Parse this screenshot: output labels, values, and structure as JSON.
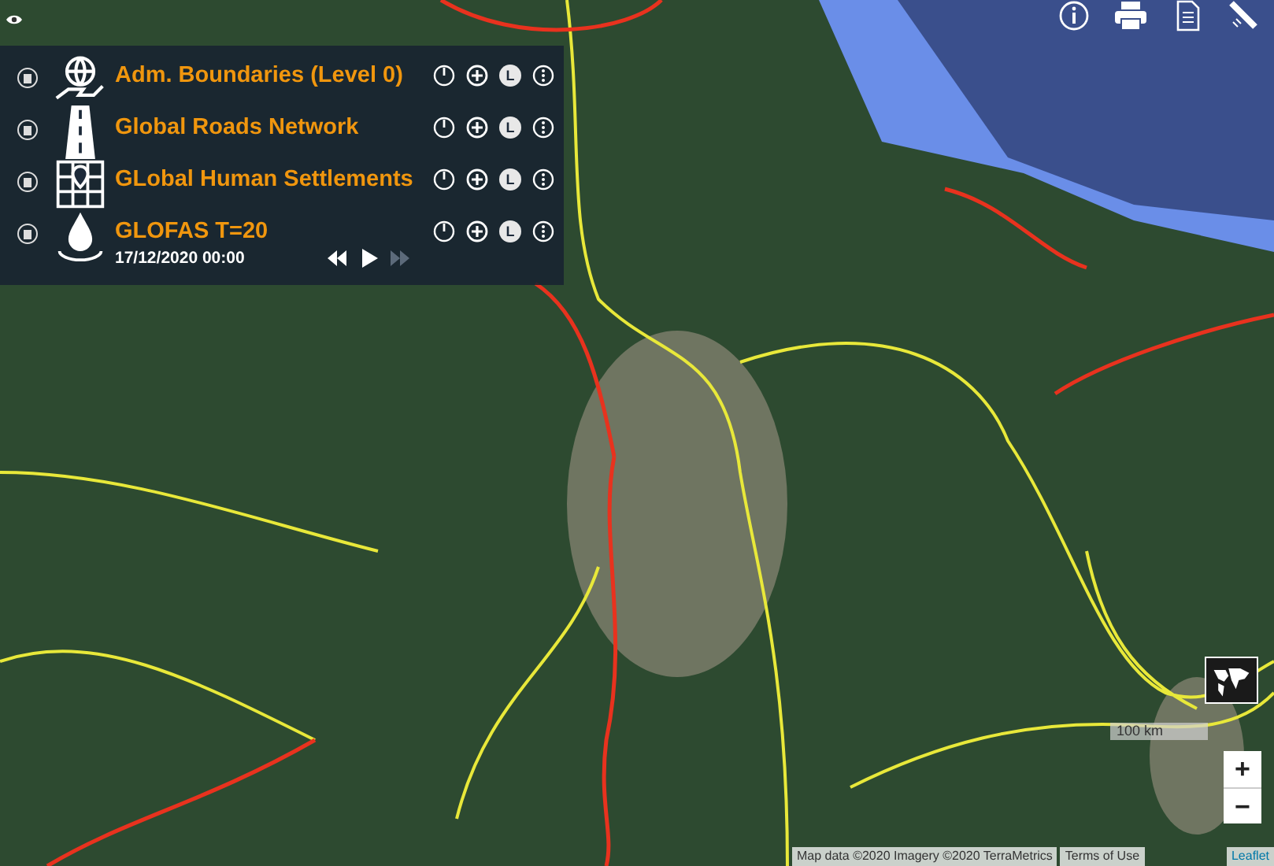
{
  "layers": [
    {
      "kind": "boundaries",
      "name": "Adm. Boundaries (Level 0)",
      "legend_label": "L"
    },
    {
      "kind": "roads",
      "name": "Global Roads Network",
      "legend_label": "L"
    },
    {
      "kind": "settlements",
      "name": "GLobal Human Settlements",
      "legend_label": "L"
    },
    {
      "kind": "flood",
      "name": "GLOFAS T=20",
      "legend_label": "L",
      "time": "17/12/2020 00:00",
      "player": [
        {
          "kind": "rewind",
          "disabled": false
        },
        {
          "kind": "play",
          "disabled": false
        },
        {
          "kind": "forward",
          "disabled": true
        }
      ]
    }
  ],
  "scale": "100 km",
  "zoom": [
    "+",
    "−"
  ],
  "attribution": {
    "text": "Map data ©2020 Imagery ©2020 TerraMetrics",
    "terms": "Terms of Use",
    "link": "Leaflet"
  }
}
